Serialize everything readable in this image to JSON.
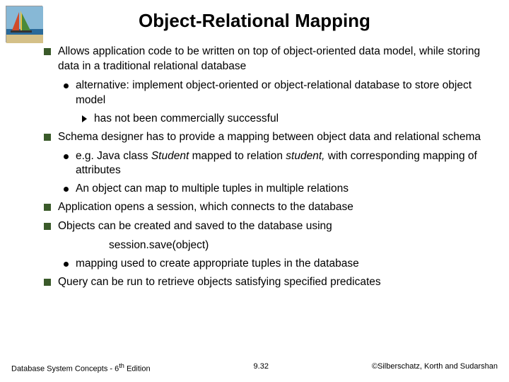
{
  "title": "Object-Relational Mapping",
  "bullets": {
    "b1": "Allows application code to be written on top of object-oriented data model, while storing data in a traditional relational database",
    "b1a": "alternative: implement object-oriented or object-relational database to store object model",
    "b1a1": "has not been commercially successful",
    "b2": "Schema designer has to provide a mapping between object data and relational schema",
    "b2a_pre": "e.g. Java class ",
    "b2a_it1": "Student",
    "b2a_mid": " mapped to relation ",
    "b2a_it2": "student,",
    "b2a_post": " with corresponding mapping of attributes",
    "b2b": "An object can map to multiple tuples in multiple relations",
    "b3": "Application opens a session, which connects to the database",
    "b4": "Objects can be created and saved to the database using",
    "b4_save": "session.save(object)",
    "b4a": "mapping used to create appropriate tuples in the database",
    "b5": "Query can be run to retrieve objects satisfying specified predicates"
  },
  "footer": {
    "left_pre": "Database System Concepts - 6",
    "left_sup": "th",
    "left_post": " Edition",
    "center": "9.32",
    "right": "©Silberschatz, Korth and Sudarshan"
  },
  "logo": {
    "sky": "#87b8d6",
    "sea": "#2a6a9a",
    "sail1": "#d04a2a",
    "sail2": "#e8c040",
    "sail3": "#4a8a3a"
  }
}
